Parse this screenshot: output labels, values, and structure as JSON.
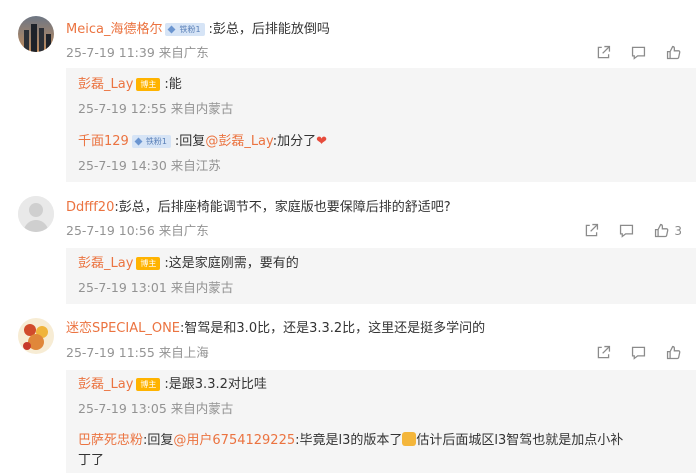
{
  "comments": [
    {
      "name": "Meica_海德格尔",
      "badge": "铁粉1",
      "text": ":彭总，后排能放倒吗",
      "time": "25-7-19 11:39",
      "location": "来自广东",
      "likes": "",
      "replies": [
        {
          "name": "彭磊_Lay",
          "badge": "博主",
          "text": ":能",
          "time": "25-7-19 12:55",
          "location": "来自内蒙古"
        },
        {
          "name": "千面129",
          "badge": "铁粉1",
          "text_prefix": ":回复",
          "mention": "@彭磊_Lay",
          "text": ":加分了",
          "emoji": "❤",
          "time": "25-7-19 14:30",
          "location": "来自江苏"
        }
      ]
    },
    {
      "name": "Ddfff20",
      "text": ":彭总，后排座椅能调节不，家庭版也要保障后排的舒适吧?",
      "time": "25-7-19 10:56",
      "location": "来自广东",
      "likes": "3",
      "replies": [
        {
          "name": "彭磊_Lay",
          "badge": "博主",
          "text": ":这是家庭刚需，要有的",
          "time": "25-7-19 13:01",
          "location": "来自内蒙古"
        }
      ]
    },
    {
      "name": "迷恋SPECIAL_ONE",
      "text": ":智驾是和3.0比，还是3.3.2比，这里还是挺多学问的",
      "time": "25-7-19 11:55",
      "location": "来自上海",
      "likes": "",
      "replies": [
        {
          "name": "彭磊_Lay",
          "badge": "博主",
          "text": ":是跟3.3.2对比哇",
          "time": "25-7-19 13:05",
          "location": "来自内蒙古"
        },
        {
          "name": "巴萨死忠粉",
          "text_prefix": ":回复",
          "mention": "@用户6754129225",
          "text": ":毕竟是l3的版本了",
          "text2": "估计后面城区l3智驾也就是加点小补",
          "text3": "丁了"
        }
      ]
    }
  ],
  "icons": {
    "share": "share-icon",
    "comment": "comment-icon",
    "like": "like-icon"
  },
  "colors": {
    "username": "#eb7340",
    "meta": "#939393",
    "reply_bg": "#f5f5f5",
    "badge_host": "#ffb300"
  }
}
